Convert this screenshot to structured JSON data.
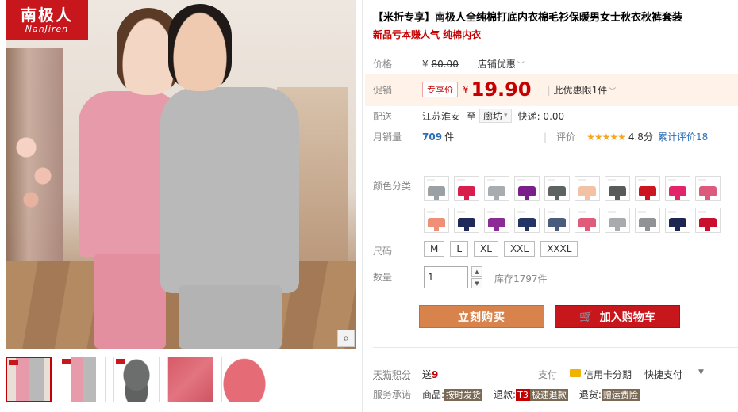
{
  "brand": {
    "logo_cn": "南极人",
    "logo_en": "NanJiren"
  },
  "icons": {
    "zoom": "magnifier-icon",
    "cart": "shopping-cart-icon",
    "card": "credit-card-icon",
    "star": "star-icon"
  },
  "product": {
    "title": "【米折专享】南极人全纯棉打底内衣棉毛衫保暖男女士秋衣秋裤套装",
    "subtitle": "新品亏本赚人气 纯棉内衣"
  },
  "price": {
    "label": "价格",
    "currency": "¥",
    "original": "80.00",
    "shop_promo": "店铺优惠",
    "promo_label": "促销",
    "promo_badge": "专享价",
    "promo_price": "19.90",
    "limit": "此优惠限1件"
  },
  "delivery": {
    "label": "配送",
    "from": "江苏淮安",
    "to_word": "至",
    "to_city": "廊坊",
    "fee": "快递: 0.00"
  },
  "sales": {
    "label": "月销量",
    "count": "709",
    "unit": "件",
    "rating_label": "评价",
    "stars": "★★★★★",
    "rating": "4.8分",
    "reviews": "累计评价18"
  },
  "options": {
    "color_label": "颜色分类",
    "swatches": [
      "#9aa0a3",
      "#d81e4a",
      "#a8acae",
      "#7a1f8a",
      "#5d6361",
      "#f3c1a4",
      "#575c5a",
      "#cf1421",
      "#e2246a",
      "#dc5a7c",
      "#f08f78",
      "#1f2a5a",
      "#8a2b96",
      "#233565",
      "#4a5c7c",
      "#e05a7a",
      "#a7abad",
      "#8f9395",
      "#1d2650",
      "#c8102e"
    ],
    "size_label": "尺码",
    "sizes": [
      "M",
      "L",
      "XL",
      "XXL",
      "XXXL"
    ],
    "qty_label": "数量",
    "qty_value": "1",
    "stock": "库存1797件"
  },
  "buttons": {
    "buy": "立刻购买",
    "cart": "加入购物车"
  },
  "extras": {
    "points_label": "天猫积分",
    "points_text": "送",
    "points_value": "9",
    "pay_label": "支付",
    "pay_card": "信用卡分期",
    "pay_fast": "快捷支付",
    "service_label": "服务承诺",
    "services": [
      {
        "prefix": "商品:",
        "tag": "按时发货"
      },
      {
        "prefix": "退款:",
        "tag_code": "T3",
        "tag": "极速退款"
      },
      {
        "prefix": "退货:",
        "tag": "赠运费险"
      }
    ]
  }
}
